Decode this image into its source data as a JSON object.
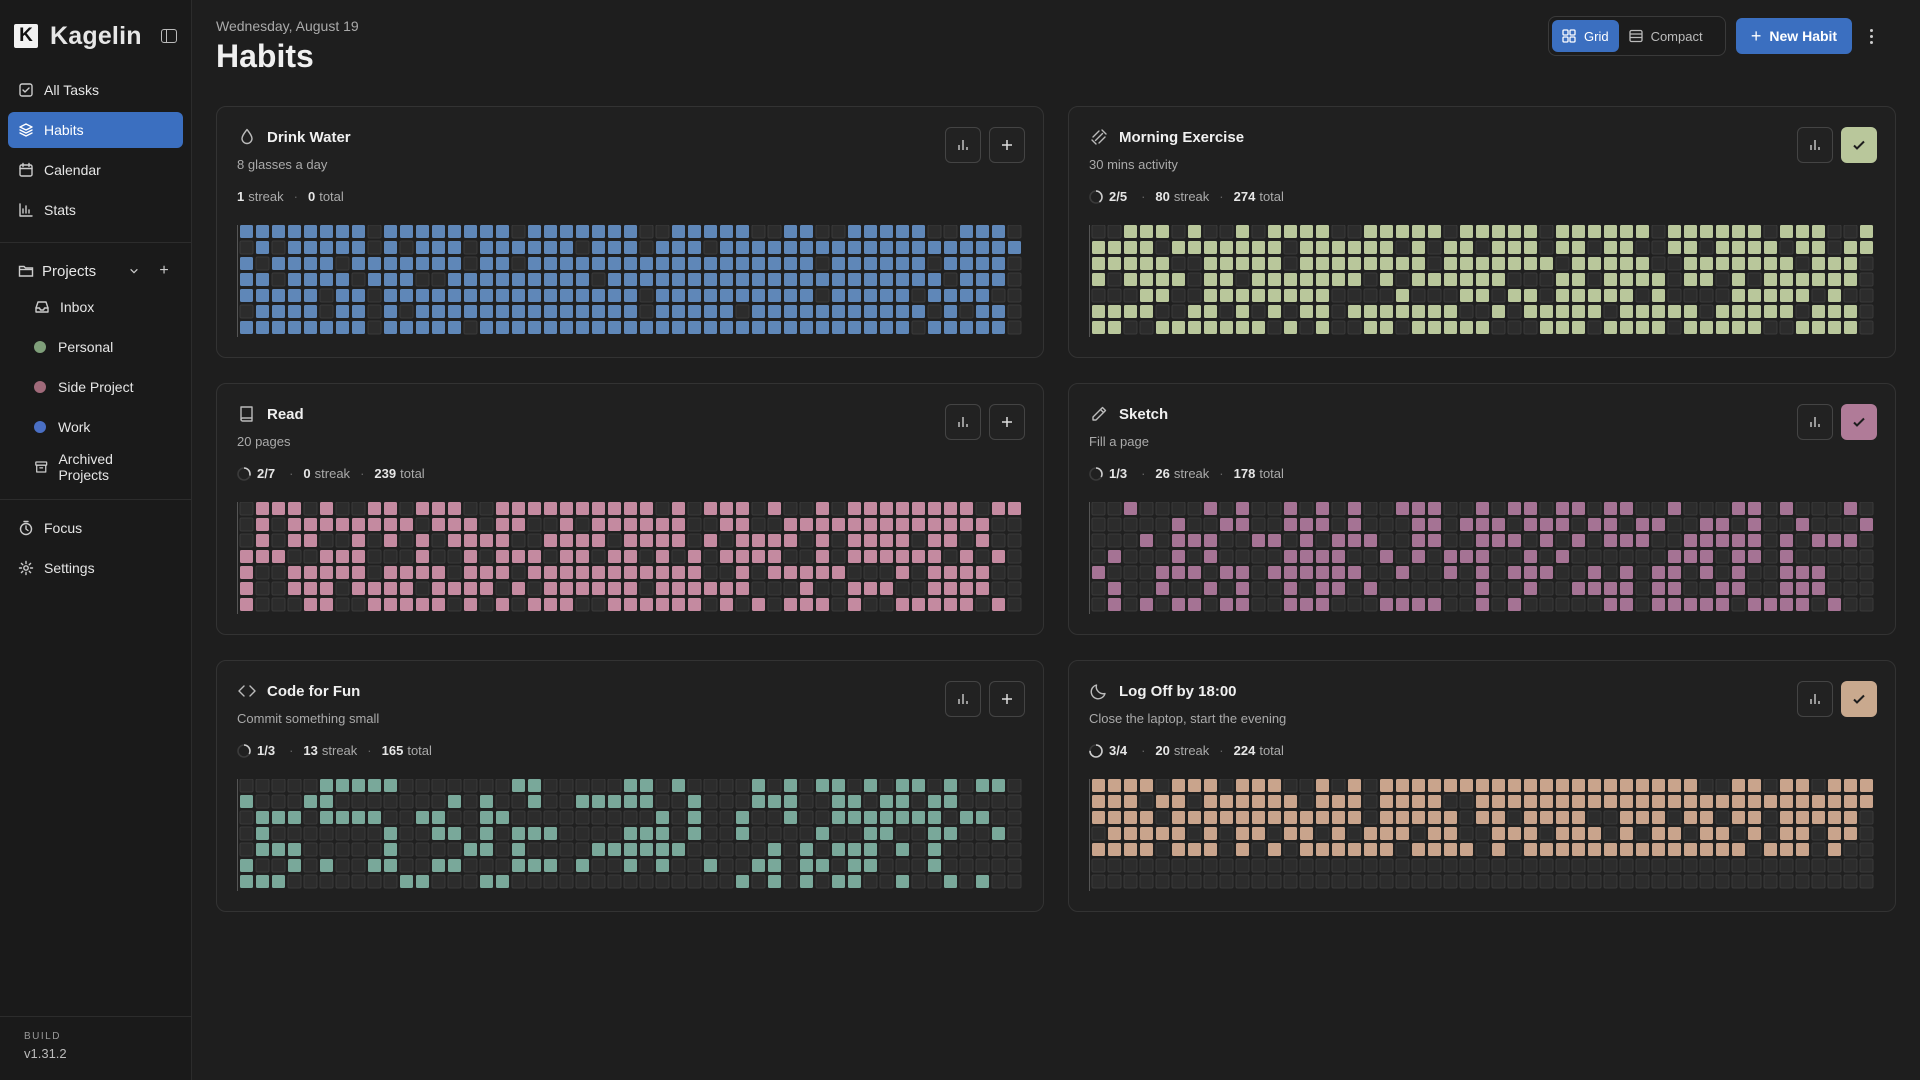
{
  "app": {
    "name": "Kagelin"
  },
  "sidebar": {
    "nav": [
      {
        "label": "All Tasks",
        "icon": "check-square-icon",
        "active": false
      },
      {
        "label": "Habits",
        "icon": "layers-icon",
        "active": true
      },
      {
        "label": "Calendar",
        "icon": "calendar-icon",
        "active": false
      },
      {
        "label": "Stats",
        "icon": "bar-chart-icon",
        "active": false
      }
    ],
    "projects_label": "Projects",
    "projects": [
      {
        "label": "Inbox",
        "type": "icon",
        "icon": "inbox-icon"
      },
      {
        "label": "Personal",
        "type": "dot",
        "color": "#7f9f7a"
      },
      {
        "label": "Side Project",
        "type": "dot",
        "color": "#a06a7a"
      },
      {
        "label": "Work",
        "type": "dot",
        "color": "#4a6fc4"
      },
      {
        "label": "Archived Projects",
        "type": "icon",
        "icon": "archive-icon"
      }
    ],
    "bottom": [
      {
        "label": "Focus",
        "icon": "timer-icon"
      },
      {
        "label": "Settings",
        "icon": "gear-icon"
      }
    ],
    "build_label": "BUILD",
    "build_version": "v1.31.2"
  },
  "header": {
    "date": "Wednesday, August 19",
    "title": "Habits",
    "view_grid": "Grid",
    "view_compact": "Compact",
    "new_habit": "New Habit"
  },
  "colors": {
    "accent": "#3b6fc0",
    "empty_cell": "#2c2c2c",
    "background": "#1e1e1e"
  },
  "habits": [
    {
      "name": "Drink Water",
      "desc": "8 glasses a day",
      "icon": "water-drop-icon",
      "progress": null,
      "streak": "1",
      "total": "0",
      "action": "add",
      "color": "#5f87b8",
      "density": 0.86,
      "seed": 3,
      "fill_rows": 7
    },
    {
      "name": "Morning Exercise",
      "desc": "30 mins activity",
      "icon": "dumbbell-icon",
      "progress": "2/5",
      "progress_value": 0.4,
      "streak": "80",
      "total": "274",
      "action": "done",
      "action_color": "#b9c79b",
      "color": "#b9c79b",
      "density": 0.72,
      "seed": 11,
      "fill_rows": 7
    },
    {
      "name": "Read",
      "desc": "20 pages",
      "icon": "book-icon",
      "progress": "2/7",
      "progress_value": 0.29,
      "streak": "0",
      "total": "239",
      "action": "add",
      "color": "#c48aa0",
      "density": 0.68,
      "seed": 23,
      "fill_rows": 7
    },
    {
      "name": "Sketch",
      "desc": "Fill a page",
      "icon": "pencil-icon",
      "progress": "1/3",
      "progress_value": 0.33,
      "streak": "26",
      "total": "178",
      "action": "done",
      "action_color": "#b07b98",
      "color": "#a57394",
      "density": 0.5,
      "seed": 37,
      "fill_rows": 7
    },
    {
      "name": "Code for Fun",
      "desc": "Commit something small",
      "icon": "code-icon",
      "progress": "1/3",
      "progress_value": 0.33,
      "streak": "13",
      "total": "165",
      "action": "add",
      "color": "#79a89a",
      "density": 0.45,
      "seed": 41,
      "fill_rows": 7
    },
    {
      "name": "Log Off by 18:00",
      "desc": "Close the laptop, start the evening",
      "icon": "moon-icon",
      "progress": "3/4",
      "progress_value": 0.75,
      "streak": "20",
      "total": "224",
      "action": "done",
      "action_color": "#c9a98e",
      "color": "#c9a48c",
      "density": 0.82,
      "seed": 53,
      "fill_rows": 5
    }
  ]
}
